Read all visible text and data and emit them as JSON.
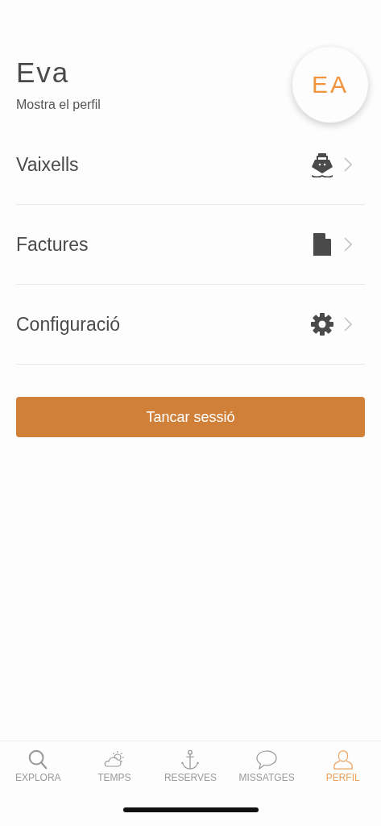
{
  "profile": {
    "name": "Eva",
    "link": "Mostra el perfil",
    "initials": "EA"
  },
  "menu": [
    {
      "label": "Vaixells",
      "kind": "boat"
    },
    {
      "label": "Factures",
      "kind": "document"
    },
    {
      "label": "Configuració",
      "kind": "gear"
    }
  ],
  "logout_button": "Tancar sessió",
  "tabs": [
    {
      "label": "EXPLORA",
      "kind": "search",
      "selected": false
    },
    {
      "label": "TEMPS",
      "kind": "weather",
      "selected": false
    },
    {
      "label": "RESERVES",
      "kind": "anchor",
      "selected": false
    },
    {
      "label": "MISSATGES",
      "kind": "chat",
      "selected": false
    },
    {
      "label": "PERFIL",
      "kind": "person",
      "selected": true
    }
  ]
}
